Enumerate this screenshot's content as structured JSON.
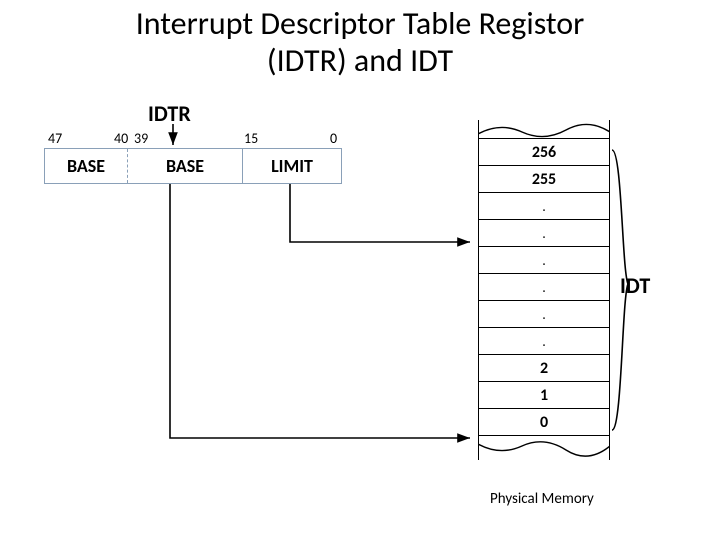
{
  "title_line1": "Interrupt Descriptor Table Registor",
  "title_line2": "(IDTR) and IDT",
  "idtr_label": "IDTR",
  "bits": {
    "b47": "47",
    "b40": "40",
    "b39": "39",
    "b15": "15",
    "b0": "0"
  },
  "reg": {
    "base_hi": "BASE",
    "base_lo": "BASE",
    "limit": "LIMIT"
  },
  "idt_label": "IDT",
  "mem_label": "Physical Memory",
  "idt_entries": {
    "e256": "256",
    "e255": "255",
    "e2": "2",
    "e1": "1",
    "e0": "0"
  }
}
